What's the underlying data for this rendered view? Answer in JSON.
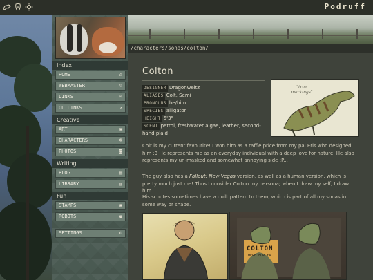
{
  "topbar": {
    "icons": [
      "dragon-icon",
      "tooth-icon",
      "sun-icon"
    ],
    "brand": "Podruff"
  },
  "sidebar": {
    "sections": [
      {
        "label": "Index",
        "items": [
          {
            "label": "HOME",
            "icon": "home-icon"
          },
          {
            "label": "WEBMASTER",
            "icon": "user-icon"
          },
          {
            "label": "LINKS",
            "icon": "link-icon"
          },
          {
            "label": "OUTLINKS",
            "icon": "external-link-icon"
          }
        ]
      },
      {
        "label": "Creative",
        "items": [
          {
            "label": "ART",
            "icon": "image-icon"
          },
          {
            "label": "CHARACTERS",
            "icon": "users-icon"
          },
          {
            "label": "PHOTOS",
            "icon": "camera-icon"
          }
        ]
      },
      {
        "label": "Writing",
        "items": [
          {
            "label": "BLOG",
            "icon": "document-icon"
          },
          {
            "label": "LIBRARY",
            "icon": "book-icon"
          }
        ]
      },
      {
        "label": "Fun",
        "items": [
          {
            "label": "STAMPS",
            "icon": "stamp-icon"
          },
          {
            "label": "ROBOTS",
            "icon": "robot-icon"
          }
        ]
      }
    ],
    "settings": {
      "label": "SETTINGS",
      "icon": "gear-icon"
    }
  },
  "path": "/characters/sonas/colton/",
  "page": {
    "title": "Colton",
    "facts": [
      {
        "key": "DESIGNER",
        "value": "Dragonweltz"
      },
      {
        "key": "ALIASES",
        "value": "Colt, Semi"
      },
      {
        "key": "PRONOUNS",
        "value": "he/him"
      },
      {
        "key": "SPECIES",
        "value": "alligator"
      },
      {
        "key": "HEIGHT",
        "value": "5'3\""
      },
      {
        "key": "SCENT",
        "value": "petrol, freshwater algae, leather, second-hand plaid"
      }
    ],
    "reference_caption": "\"true markings\"",
    "paragraphs": {
      "p1": "Colt is my current favourite! I won him as a raffle price from my pal Eris who designed him :3 He represents me as an everyday individual with a deep love for nature. He also represents my un-masked and somewhat annoying side :P...",
      "p2_pre": "The guy also has a ",
      "p2_em": "Fallout: New Vegas",
      "p2_post": " version, as well as a human version, which is pretty much just me! Thus I consider Colton my persona; when I draw my self, I draw him.",
      "p3": "His schutes sometimes have a quilt pattern to them, which is part of all my sonas in some way or shape."
    },
    "art2_text": {
      "line1": "COLTON",
      "line2": "HERE FOR YA"
    }
  }
}
